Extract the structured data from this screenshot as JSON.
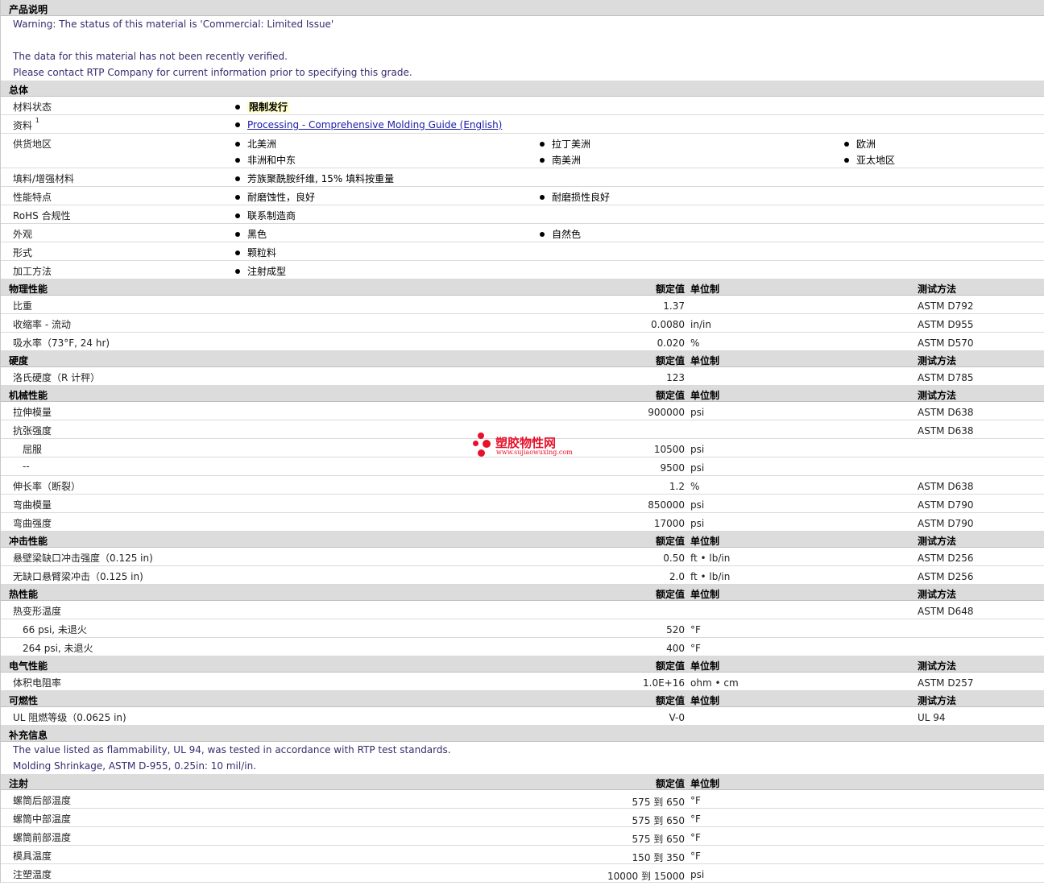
{
  "product": {
    "title": "产品说明",
    "warning": "Warning: The status of this material is 'Commercial: Limited Issue'",
    "verify1": "The data for this material has not been recently verified.",
    "verify2": "Please contact RTP Company for current information prior to specifying this grade."
  },
  "general": {
    "title": "总体",
    "status_label": "材料状态",
    "status_value": "限制发行",
    "docs_label": "资料",
    "docs_sup": "1",
    "docs_link": "Processing - Comprehensive Molding Guide (English)",
    "regions_label": "供货地区",
    "regions": [
      "北美洲",
      "拉丁美洲",
      "欧洲",
      "非洲和中东",
      "南美洲",
      "亚太地区"
    ],
    "filler_label": "填料/增强材料",
    "filler_value": "芳族聚酰胺纤维, 15% 填料按重量",
    "features_label": "性能特点",
    "features": [
      "耐磨蚀性，良好",
      "耐磨损性良好"
    ],
    "rohs_label": "RoHS 合规性",
    "rohs_value": "联系制造商",
    "appearance_label": "外观",
    "appearance": [
      "黑色",
      "自然色"
    ],
    "form_label": "形式",
    "form_value": "颗粒料",
    "process_label": "加工方法",
    "process_value": "注射成型"
  },
  "cols": {
    "nominal": "额定值",
    "unit": "单位制",
    "method": "测试方法"
  },
  "physical": {
    "title": "物理性能",
    "rows": [
      {
        "label": "比重",
        "value": "1.37",
        "unit": "",
        "method": "ASTM D792"
      },
      {
        "label": "收缩率 - 流动",
        "value": "0.0080",
        "unit": "in/in",
        "method": "ASTM D955"
      },
      {
        "label": "吸水率（73°F, 24 hr)",
        "value": "0.020",
        "unit": "%",
        "method": "ASTM D570"
      }
    ]
  },
  "hardness": {
    "title": "硬度",
    "rows": [
      {
        "label": "洛氏硬度（R 计秤）",
        "value": "123",
        "unit": "",
        "method": "ASTM D785"
      }
    ]
  },
  "mechanical": {
    "title": "机械性能",
    "rows": [
      {
        "label": "拉伸模量",
        "value": "900000",
        "unit": "psi",
        "method": "ASTM D638"
      },
      {
        "label": "抗张强度",
        "value": "",
        "unit": "",
        "method": "ASTM D638"
      },
      {
        "label": "屈服",
        "value": "10500",
        "unit": "psi",
        "method": ""
      },
      {
        "label": "--",
        "value": "9500",
        "unit": "psi",
        "method": ""
      },
      {
        "label": "伸长率（断裂）",
        "value": "1.2",
        "unit": "%",
        "method": "ASTM D638"
      },
      {
        "label": "弯曲模量",
        "value": "850000",
        "unit": "psi",
        "method": "ASTM D790"
      },
      {
        "label": "弯曲强度",
        "value": "17000",
        "unit": "psi",
        "method": "ASTM D790"
      }
    ]
  },
  "impact": {
    "title": "冲击性能",
    "rows": [
      {
        "label": "悬壁梁缺口冲击强度（0.125 in)",
        "value": "0.50",
        "unit": "ft • lb/in",
        "method": "ASTM D256"
      },
      {
        "label": "无缺口悬臂梁冲击（0.125 in)",
        "value": "2.0",
        "unit": "ft • lb/in",
        "method": "ASTM D256"
      }
    ]
  },
  "thermal": {
    "title": "热性能",
    "rows": [
      {
        "label": "热变形温度",
        "value": "",
        "unit": "",
        "method": "ASTM D648"
      },
      {
        "label": "66 psi, 未退火",
        "value": "520",
        "unit": "°F",
        "method": ""
      },
      {
        "label": "264 psi, 未退火",
        "value": "400",
        "unit": "°F",
        "method": ""
      }
    ]
  },
  "electrical": {
    "title": "电气性能",
    "rows": [
      {
        "label": "体积电阻率",
        "value": "1.0E+16",
        "unit": "ohm • cm",
        "method": "ASTM D257"
      }
    ]
  },
  "flammability": {
    "title": "可燃性",
    "rows": [
      {
        "label": "UL 阻燃等级（0.0625 in)",
        "value": "V-0",
        "unit": "",
        "method": "UL 94"
      }
    ]
  },
  "supplement": {
    "title": "补充信息",
    "line1": "The value listed as flammability, UL 94, was tested in accordance with RTP test standards.",
    "line2": "Molding Shrinkage, ASTM D-955, 0.25in: 10 mil/in."
  },
  "injection": {
    "title": "注射",
    "rows": [
      {
        "label": "螺筒后部温度",
        "value": "575 到 650",
        "unit": "°F"
      },
      {
        "label": "螺筒中部温度",
        "value": "575 到 650",
        "unit": "°F"
      },
      {
        "label": "螺筒前部温度",
        "value": "575 到 650",
        "unit": "°F"
      },
      {
        "label": "模具温度",
        "value": "150 到 350",
        "unit": "°F"
      },
      {
        "label": "注塑温度",
        "value": "10000 到 15000",
        "unit": "psi"
      }
    ]
  },
  "watermark": {
    "name": "塑胶物性网",
    "url": "www.sujiaowuxing.com"
  }
}
